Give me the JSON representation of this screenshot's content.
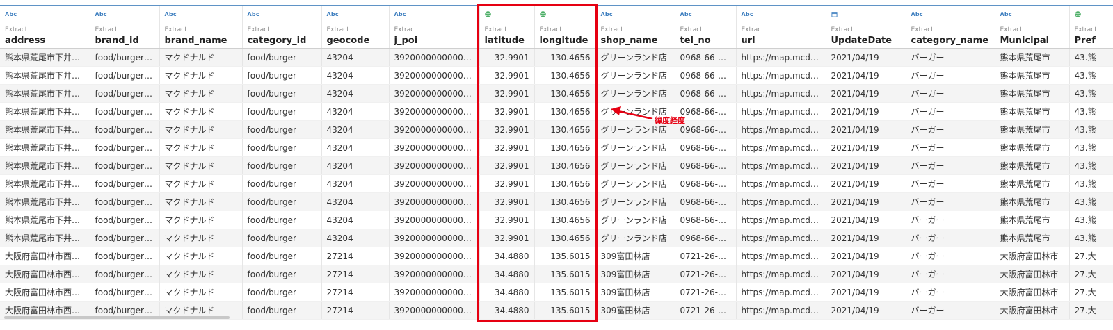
{
  "columns": [
    {
      "name": "address",
      "type": "Abc",
      "source": "Extract"
    },
    {
      "name": "brand_id",
      "type": "Abc",
      "source": "Extract"
    },
    {
      "name": "brand_name",
      "type": "Abc",
      "source": "Extract"
    },
    {
      "name": "category_id",
      "type": "Abc",
      "source": "Extract"
    },
    {
      "name": "geocode",
      "type": "Abc",
      "source": "Extract"
    },
    {
      "name": "j_poi",
      "type": "Abc",
      "source": "Extract"
    },
    {
      "name": "latitude",
      "type": "globe-icon",
      "source": "Extract"
    },
    {
      "name": "longitude",
      "type": "globe-icon",
      "source": "Extract"
    },
    {
      "name": "shop_name",
      "type": "Abc",
      "source": "Extract"
    },
    {
      "name": "tel_no",
      "type": "Abc",
      "source": "Extract"
    },
    {
      "name": "url",
      "type": "Abc",
      "source": "Extract"
    },
    {
      "name": "UpdateDate",
      "type": "calendar-icon",
      "source": "Extract"
    },
    {
      "name": "category_name",
      "type": "Abc",
      "source": "Extract"
    },
    {
      "name": "Municipal",
      "type": "Abc",
      "source": "Extract"
    },
    {
      "name": "Pref",
      "type": "globe-icon",
      "source": "Extract"
    }
  ],
  "rows": [
    [
      "熊本県荒尾市下井手1…",
      "food/burger/mac",
      "マクドナルド",
      "food/burger",
      "43204",
      "3920000000000223…",
      "32.9901",
      "130.4656",
      "グリーンランド店",
      "0968-66-1186",
      "https://map.mcdona…",
      "2021/04/19",
      "バーガー",
      "熊本県荒尾市",
      "43.熊"
    ],
    [
      "熊本県荒尾市下井手1…",
      "food/burger/mac",
      "マクドナルド",
      "food/burger",
      "43204",
      "3920000000000223…",
      "32.9901",
      "130.4656",
      "グリーンランド店",
      "0968-66-1186",
      "https://map.mcdona…",
      "2021/04/19",
      "バーガー",
      "熊本県荒尾市",
      "43.熊"
    ],
    [
      "熊本県荒尾市下井手1…",
      "food/burger/mac",
      "マクドナルド",
      "food/burger",
      "43204",
      "3920000000000223…",
      "32.9901",
      "130.4656",
      "グリーンランド店",
      "0968-66-1186",
      "https://map.mcdona…",
      "2021/04/19",
      "バーガー",
      "熊本県荒尾市",
      "43.熊"
    ],
    [
      "熊本県荒尾市下井手1…",
      "food/burger/mac",
      "マクドナルド",
      "food/burger",
      "43204",
      "3920000000000223…",
      "32.9901",
      "130.4656",
      "グリーンランド店",
      "0968-66-1186",
      "https://map.mcdona…",
      "2021/04/19",
      "バーガー",
      "熊本県荒尾市",
      "43.熊"
    ],
    [
      "熊本県荒尾市下井手1…",
      "food/burger/mac",
      "マクドナルド",
      "food/burger",
      "43204",
      "3920000000000223…",
      "32.9901",
      "130.4656",
      "グリーンランド店",
      "0968-66-1186",
      "https://map.mcdona…",
      "2021/04/19",
      "バーガー",
      "熊本県荒尾市",
      "43.熊"
    ],
    [
      "熊本県荒尾市下井手1…",
      "food/burger/mac",
      "マクドナルド",
      "food/burger",
      "43204",
      "3920000000000223…",
      "32.9901",
      "130.4656",
      "グリーンランド店",
      "0968-66-1186",
      "https://map.mcdona…",
      "2021/04/19",
      "バーガー",
      "熊本県荒尾市",
      "43.熊"
    ],
    [
      "熊本県荒尾市下井手1…",
      "food/burger/mac",
      "マクドナルド",
      "food/burger",
      "43204",
      "3920000000000223…",
      "32.9901",
      "130.4656",
      "グリーンランド店",
      "0968-66-1186",
      "https://map.mcdona…",
      "2021/04/19",
      "バーガー",
      "熊本県荒尾市",
      "43.熊"
    ],
    [
      "熊本県荒尾市下井手1…",
      "food/burger/mac",
      "マクドナルド",
      "food/burger",
      "43204",
      "3920000000000223…",
      "32.9901",
      "130.4656",
      "グリーンランド店",
      "0968-66-1186",
      "https://map.mcdona…",
      "2021/04/19",
      "バーガー",
      "熊本県荒尾市",
      "43.熊"
    ],
    [
      "熊本県荒尾市下井手1…",
      "food/burger/mac",
      "マクドナルド",
      "food/burger",
      "43204",
      "3920000000000223…",
      "32.9901",
      "130.4656",
      "グリーンランド店",
      "0968-66-1186",
      "https://map.mcdona…",
      "2021/04/19",
      "バーガー",
      "熊本県荒尾市",
      "43.熊"
    ],
    [
      "熊本県荒尾市下井手1…",
      "food/burger/mac",
      "マクドナルド",
      "food/burger",
      "43204",
      "3920000000000223…",
      "32.9901",
      "130.4656",
      "グリーンランド店",
      "0968-66-1186",
      "https://map.mcdona…",
      "2021/04/19",
      "バーガー",
      "熊本県荒尾市",
      "43.熊"
    ],
    [
      "熊本県荒尾市下井手1…",
      "food/burger/mac",
      "マクドナルド",
      "food/burger",
      "43204",
      "3920000000000223…",
      "32.9901",
      "130.4656",
      "グリーンランド店",
      "0968-66-1186",
      "https://map.mcdona…",
      "2021/04/19",
      "バーガー",
      "熊本県荒尾市",
      "43.熊"
    ],
    [
      "大阪府富田林市西板持…",
      "food/burger/mac",
      "マクドナルド",
      "food/burger",
      "27214",
      "3920000000000223…",
      "34.4880",
      "135.6015",
      "309富田林店",
      "0721-26-7047",
      "https://map.mcdona…",
      "2021/04/19",
      "バーガー",
      "大阪府富田林市",
      "27.大"
    ],
    [
      "大阪府富田林市西板持…",
      "food/burger/mac",
      "マクドナルド",
      "food/burger",
      "27214",
      "3920000000000223…",
      "34.4880",
      "135.6015",
      "309富田林店",
      "0721-26-7047",
      "https://map.mcdona…",
      "2021/04/19",
      "バーガー",
      "大阪府富田林市",
      "27.大"
    ],
    [
      "大阪府富田林市西板持…",
      "food/burger/mac",
      "マクドナルド",
      "food/burger",
      "27214",
      "3920000000000223…",
      "34.4880",
      "135.6015",
      "309富田林店",
      "0721-26-7047",
      "https://map.mcdona…",
      "2021/04/19",
      "バーガー",
      "大阪府富田林市",
      "27.大"
    ],
    [
      "大阪府富田林市西板持…",
      "food/burger/mac",
      "マクドナルド",
      "food/burger",
      "27214",
      "3920000000000223…",
      "34.4880",
      "135.6015",
      "309富田林店",
      "0721-26-7047",
      "https://map.mcdona…",
      "2021/04/19",
      "バーガー",
      "大阪府富田林市",
      "27.大"
    ]
  ],
  "annotation": {
    "label": "緯度経度",
    "color": "#e60012"
  },
  "colors": {
    "accent": "#3d7ebf",
    "highlight": "#e60012",
    "header_rule": "#5f93c6"
  }
}
